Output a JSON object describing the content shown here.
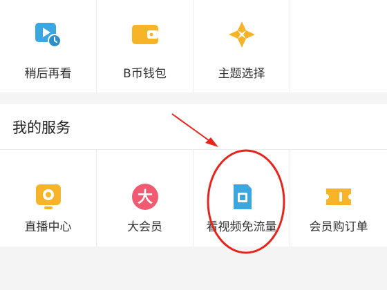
{
  "top_grid": [
    {
      "label": "稍后再看",
      "icon": "watch-later-icon"
    },
    {
      "label": "B币钱包",
      "icon": "wallet-icon"
    },
    {
      "label": "主题选择",
      "icon": "theme-icon"
    },
    {
      "label": "",
      "icon": ""
    }
  ],
  "services": {
    "title": "我的服务",
    "items": [
      {
        "label": "直播中心",
        "icon": "live-center-icon"
      },
      {
        "label": "大会员",
        "icon": "vip-icon"
      },
      {
        "label": "看视频免流量",
        "icon": "sim-card-icon"
      },
      {
        "label": "会员购订单",
        "icon": "ticket-icon"
      }
    ]
  },
  "colors": {
    "accent_yellow": "#f8b428",
    "accent_blue": "#3aa7e0",
    "accent_pink": "#f05b72",
    "annotation_red": "#e8231b"
  }
}
